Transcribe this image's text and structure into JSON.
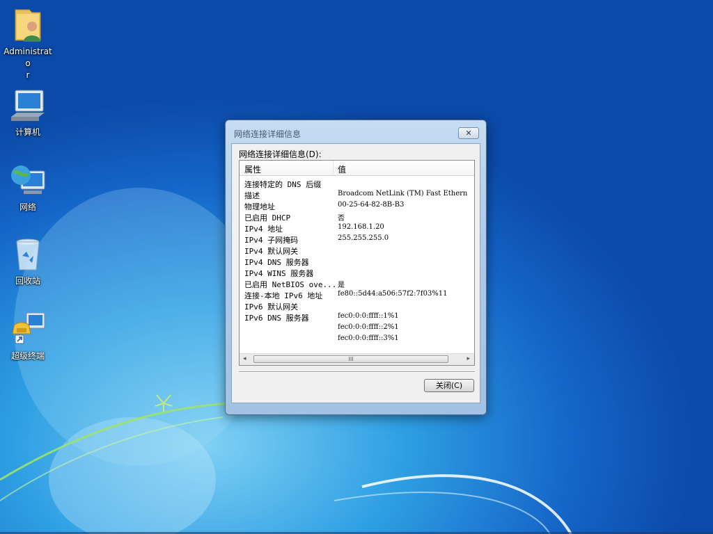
{
  "desktop": {
    "icons": [
      {
        "label": "Administrato\nr"
      },
      {
        "label": "计算机"
      },
      {
        "label": "网络"
      },
      {
        "label": "回收站"
      },
      {
        "label": "超级终端"
      }
    ]
  },
  "dialog": {
    "title": "网络连接详细信息",
    "close_icon_glyph": "✕",
    "section_label": "网络连接详细信息(D):",
    "columns": {
      "property": "属性",
      "value": "值"
    },
    "rows": [
      {
        "property": "连接特定的 DNS 后缀",
        "value": ""
      },
      {
        "property": "描述",
        "value": "Broadcom NetLink (TM) Fast Ethern"
      },
      {
        "property": "物理地址",
        "value": "00-25-64-82-8B-B3"
      },
      {
        "property": "已启用 DHCP",
        "value": "否"
      },
      {
        "property": "IPv4 地址",
        "value": "192.168.1.20"
      },
      {
        "property": "IPv4 子网掩码",
        "value": "255.255.255.0"
      },
      {
        "property": "IPv4 默认网关",
        "value": ""
      },
      {
        "property": "IPv4 DNS 服务器",
        "value": ""
      },
      {
        "property": "IPv4 WINS 服务器",
        "value": ""
      },
      {
        "property": "已启用 NetBIOS ove...",
        "value": "是"
      },
      {
        "property": "连接-本地 IPv6 地址",
        "value": "fe80::5d44:a506:57f2:7f03%11"
      },
      {
        "property": "IPv6 默认网关",
        "value": ""
      },
      {
        "property": "IPv6 DNS 服务器",
        "value": "fec0:0:0:ffff::1%1"
      },
      {
        "property": "",
        "value": "fec0:0:0:ffff::2%1"
      },
      {
        "property": "",
        "value": "fec0:0:0:ffff::3%1"
      }
    ],
    "scrollbar": {
      "left_arrow": "◂",
      "right_arrow": "▸",
      "grip": "III"
    },
    "close_button_label": "关闭(C)"
  },
  "colors": {
    "desktop_blue": "#1565c8",
    "dialog_frame": "#aecbea"
  }
}
